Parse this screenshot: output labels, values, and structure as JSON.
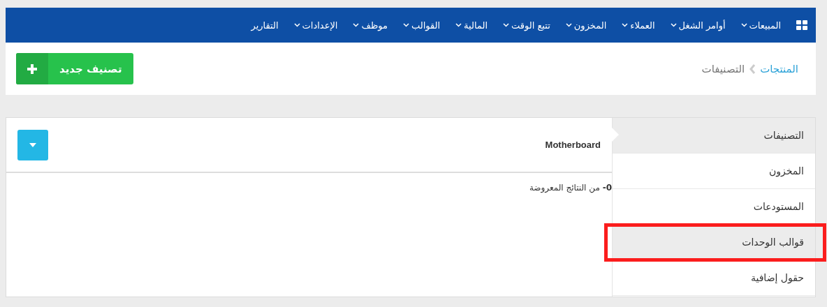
{
  "navbar": {
    "items": [
      {
        "label": "المبيعات",
        "dropdown": true
      },
      {
        "label": "أوامر الشغل",
        "dropdown": true
      },
      {
        "label": "العملاء",
        "dropdown": true
      },
      {
        "label": "المخزون",
        "dropdown": true
      },
      {
        "label": "تتبع الوقت",
        "dropdown": true
      },
      {
        "label": "المالية",
        "dropdown": true
      },
      {
        "label": "القوالب",
        "dropdown": true
      },
      {
        "label": "موظف",
        "dropdown": true
      },
      {
        "label": "الإعدادات",
        "dropdown": true
      },
      {
        "label": "التقارير",
        "dropdown": false
      }
    ]
  },
  "breadcrumb": [
    {
      "label": "المنتجات",
      "link": true
    },
    {
      "label": "التصنيفات",
      "link": false
    }
  ],
  "new_button": {
    "label": "تصنيف جديد"
  },
  "sidebar": {
    "items": [
      {
        "label": "التصنيفات",
        "selected": true,
        "highlighted": false
      },
      {
        "label": "المخزون",
        "selected": false,
        "highlighted": false
      },
      {
        "label": "المستودعات",
        "selected": false,
        "highlighted": false
      },
      {
        "label": "قوالب الوحدات",
        "selected": false,
        "highlighted": true
      },
      {
        "label": "حقول إضافية",
        "selected": false,
        "highlighted": false
      }
    ]
  },
  "content": {
    "title": "Motherboard",
    "results": "**0-** من النتائج المعروضة"
  }
}
